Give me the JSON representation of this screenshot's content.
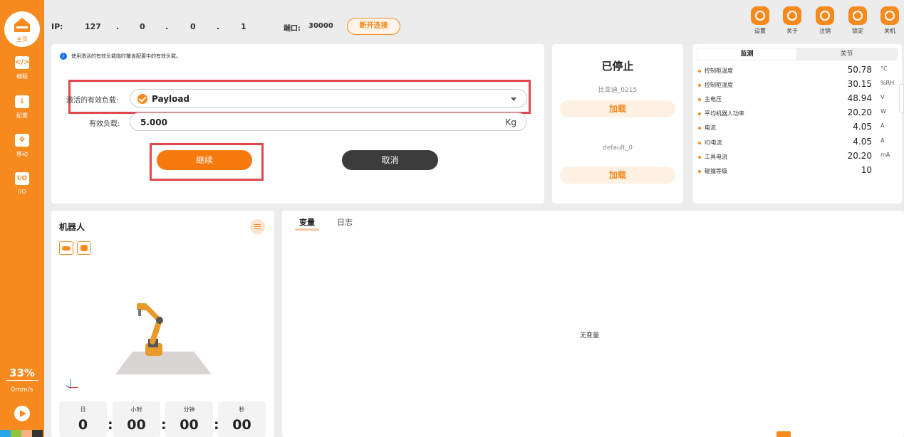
{
  "sidebar": {
    "home_label": "主页",
    "items": [
      {
        "label": "编程",
        "icon": "code-icon",
        "glyph": "</>"
      },
      {
        "label": "配置",
        "icon": "download-icon",
        "glyph": "↓"
      },
      {
        "label": "移动",
        "icon": "move-icon",
        "glyph": "✥"
      },
      {
        "label": "I/O",
        "icon": "io-icon",
        "glyph": "I/O"
      }
    ],
    "speed_percent": "33%",
    "speed_value": "0mm/s"
  },
  "topbar": {
    "ip_label": "IP:",
    "ip": [
      "127",
      ".",
      "0",
      ".",
      "0",
      ".",
      "1"
    ],
    "port_label": "端口:",
    "port_value": "30000",
    "disconnect_label": "断开连接",
    "tools": [
      {
        "label": "设置",
        "icon": "gear-icon"
      },
      {
        "label": "关于",
        "icon": "info-icon"
      },
      {
        "label": "注销",
        "icon": "logout-icon"
      },
      {
        "label": "锁定",
        "icon": "lock-icon"
      },
      {
        "label": "关机",
        "icon": "power-icon"
      }
    ]
  },
  "payload": {
    "note": "使用激活的有效负载临时覆盖配置中的有效负载。",
    "active_label": "激活的有效负载:",
    "active_value": "Payload",
    "mass_label": "有效负载:",
    "mass_value": "5.000",
    "mass_unit": "Kg",
    "continue_label": "继续",
    "cancel_label": "取消"
  },
  "status": {
    "title": "已停止",
    "programs": [
      {
        "name": "比亚迪_0215",
        "load_label": "加载"
      },
      {
        "name": "default_0",
        "load_label": "加载"
      }
    ]
  },
  "monitor": {
    "tabs": [
      "监测",
      "关节"
    ],
    "rows": [
      {
        "name": "控制柜温度",
        "value": "50.78",
        "unit": "°C"
      },
      {
        "name": "控制柜湿度",
        "value": "30.15",
        "unit": "%RH"
      },
      {
        "name": "主电压",
        "value": "48.94",
        "unit": "V"
      },
      {
        "name": "平均机器人功率",
        "value": "20.20",
        "unit": "W"
      },
      {
        "name": "电流",
        "value": "4.05",
        "unit": "A"
      },
      {
        "name": "IO电流",
        "value": "4.05",
        "unit": "A"
      },
      {
        "name": "工具电流",
        "value": "20.20",
        "unit": "mA"
      },
      {
        "name": "碰撞等级",
        "value": "10",
        "unit": ""
      }
    ]
  },
  "robot": {
    "title": "机器人",
    "timer": [
      {
        "label": "日",
        "value": "0"
      },
      {
        "label": "小时",
        "value": "00"
      },
      {
        "label": "分钟",
        "value": "00"
      },
      {
        "label": "秒",
        "value": "00"
      }
    ],
    "separator": ":"
  },
  "variables": {
    "tabs": [
      "变量",
      "日志"
    ],
    "empty_message": "无变量"
  },
  "colors": {
    "accent": "#f68a1e",
    "highlight": "#e0474f",
    "dark_button": "#3c3c3c"
  }
}
